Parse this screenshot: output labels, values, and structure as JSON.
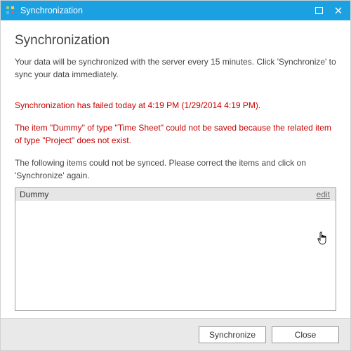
{
  "window": {
    "title": "Synchronization"
  },
  "page": {
    "heading": "Synchronization",
    "description": "Your data will be synchronized with the server every 15 minutes. Click 'Synchronize' to sync your data immediately."
  },
  "error": {
    "line1": "Synchronization has failed today at 4:19 PM (1/29/2014 4:19 PM).",
    "line2": "The item \"Dummy\" of type \"Time Sheet\" could not be saved because the related item of type \"Project\" does not exist."
  },
  "instruction": "The following items could not be synced. Please correct the items and click on 'Synchronize' again.",
  "list": {
    "items": [
      {
        "name": "Dummy",
        "action": "edit"
      }
    ]
  },
  "footer": {
    "synchronize": "Synchronize",
    "close": "Close"
  },
  "colors": {
    "accent": "#1ba1e2",
    "error": "#c80000"
  }
}
